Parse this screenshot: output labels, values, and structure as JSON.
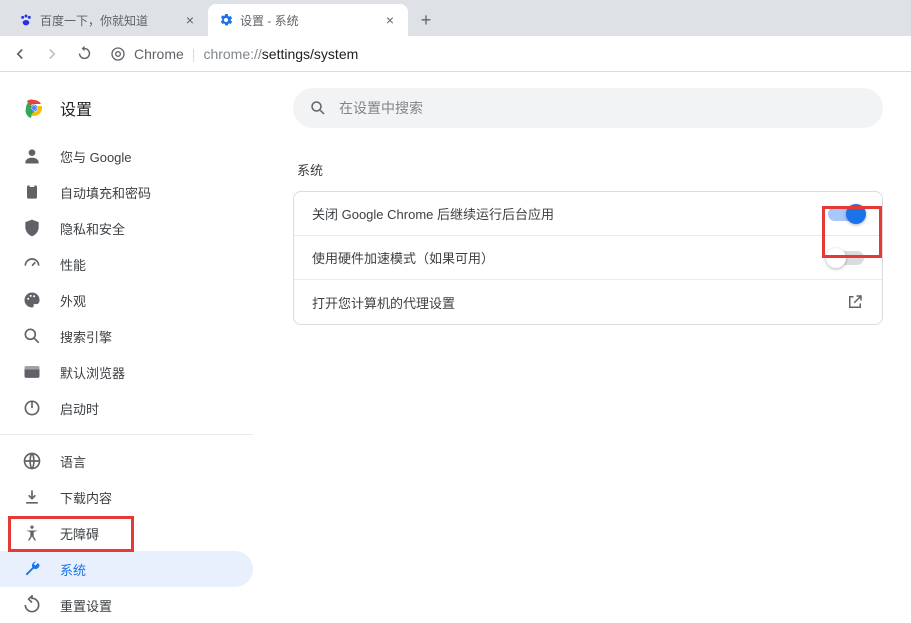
{
  "tabs": [
    {
      "title": "百度一下，你就知道",
      "active": false,
      "favicon": "baidu"
    },
    {
      "title": "设置 - 系统",
      "active": true,
      "favicon": "gear"
    }
  ],
  "address": {
    "label": "Chrome",
    "url_scheme": "chrome://",
    "url_path": "settings/system"
  },
  "brand": {
    "title": "设置"
  },
  "search": {
    "placeholder": "在设置中搜索"
  },
  "sidebar": {
    "items_a": [
      {
        "id": "you-and-google",
        "label": "您与 Google"
      },
      {
        "id": "autofill",
        "label": "自动填充和密码"
      },
      {
        "id": "privacy",
        "label": "隐私和安全"
      },
      {
        "id": "performance",
        "label": "性能"
      },
      {
        "id": "appearance",
        "label": "外观"
      },
      {
        "id": "search-engine",
        "label": "搜索引擎"
      },
      {
        "id": "default-browser",
        "label": "默认浏览器"
      },
      {
        "id": "on-startup",
        "label": "启动时"
      }
    ],
    "items_b": [
      {
        "id": "languages",
        "label": "语言"
      },
      {
        "id": "downloads",
        "label": "下载内容"
      },
      {
        "id": "accessibility",
        "label": "无障碍"
      },
      {
        "id": "system",
        "label": "系统",
        "active": true
      },
      {
        "id": "reset",
        "label": "重置设置"
      }
    ]
  },
  "section": {
    "title": "系统",
    "rows": {
      "background_apps": "关闭 Google Chrome 后继续运行后台应用",
      "hardware_accel": "使用硬件加速模式（如果可用）",
      "proxy": "打开您计算机的代理设置"
    },
    "toggles": {
      "background_apps": true,
      "hardware_accel": false
    }
  }
}
